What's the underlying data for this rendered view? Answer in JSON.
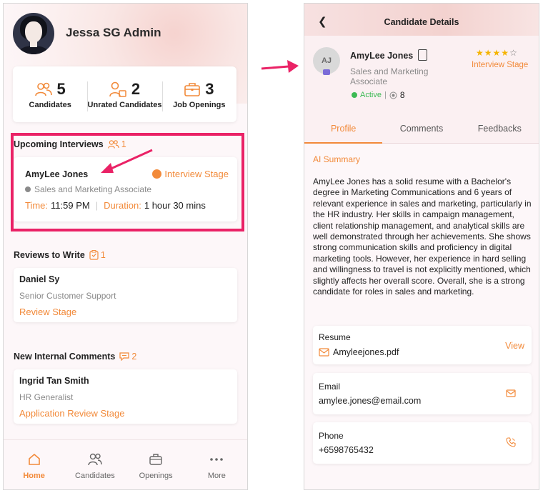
{
  "left_screen": {
    "admin_name": "Jessa SG Admin",
    "stats": [
      {
        "icon": "people-icon",
        "value": "5",
        "label": "Candidates"
      },
      {
        "icon": "unrated-people-icon",
        "value": "2",
        "label": "Unrated Candidates"
      },
      {
        "icon": "briefcase-icon",
        "value": "3",
        "label": "Job Openings"
      }
    ],
    "upcoming": {
      "title": "Upcoming Interviews",
      "count": "1",
      "card": {
        "name": "AmyLee Jones",
        "stage": "Interview Stage",
        "role": "Sales and Marketing Associate",
        "time_label": "Time:",
        "time_value": "11:59 PM",
        "duration_label": "Duration:",
        "duration_value": "1 hour 30 mins"
      }
    },
    "reviews": {
      "title": "Reviews to Write",
      "count": "1",
      "card": {
        "name": "Daniel Sy",
        "role": "Senior Customer Support",
        "stage": "Review Stage"
      }
    },
    "comments": {
      "title": "New Internal Comments",
      "count": "2",
      "card": {
        "name": "Ingrid Tan Smith",
        "role": "HR Generalist",
        "stage": "Application Review Stage"
      }
    },
    "nav": [
      {
        "label": "Home",
        "icon": "home-icon",
        "active": true
      },
      {
        "label": "Candidates",
        "icon": "people-icon",
        "active": false
      },
      {
        "label": "Openings",
        "icon": "briefcase-icon",
        "active": false
      },
      {
        "label": "More",
        "icon": "more-icon",
        "active": false
      }
    ]
  },
  "right_screen": {
    "title": "Candidate Details",
    "avatar_initials": "AJ",
    "name": "AmyLee Jones",
    "role": "Sales and Marketing Associate",
    "status": "Active",
    "status_sep": "|",
    "views": "8",
    "rating": 4,
    "rating_max": 5,
    "stage": "Interview Stage",
    "tabs": [
      "Profile",
      "Comments",
      "Feedbacks"
    ],
    "ai_summary_label": "AI Summary",
    "ai_summary": "AmyLee Jones has a solid resume with a Bachelor's degree in Marketing Communications and 6 years of relevant experience in sales and marketing, particularly in the HR industry. Her skills in campaign management, client relationship management, and analytical skills are well demonstrated through her achievements. She shows strong communication skills and proficiency in digital marketing tools. However, her experience in hard selling and willingness to travel is not explicitly mentioned, which slightly affects her overall score. Overall, she is a strong candidate for roles in sales and marketing.",
    "resume": {
      "label": "Resume",
      "file": "Amyleejones.pdf",
      "action": "View"
    },
    "email": {
      "label": "Email",
      "value": "amylee.jones@email.com"
    },
    "phone": {
      "label": "Phone",
      "value": "+6598765432"
    }
  },
  "colors": {
    "accent": "#f28a3a",
    "highlight": "#ea2266",
    "active_green": "#3cba54",
    "star": "#f5b400"
  }
}
